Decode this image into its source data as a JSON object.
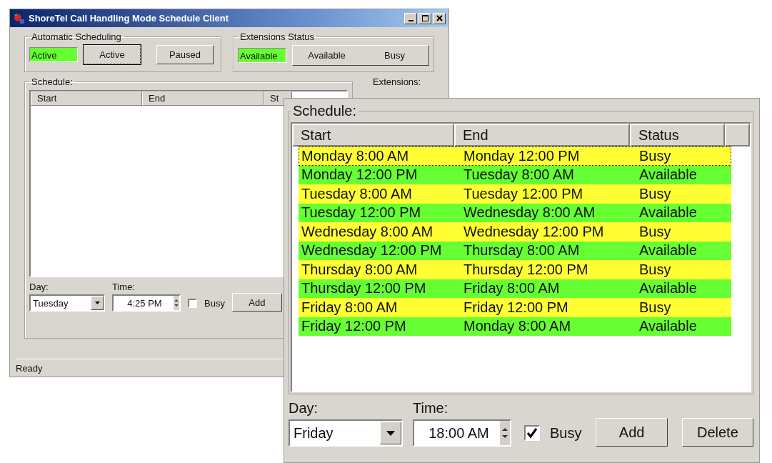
{
  "window": {
    "title": "ShoreTel Call Handling Mode Schedule Client"
  },
  "automatic_scheduling": {
    "label": "Automatic Scheduling",
    "indicator": {
      "text": "Active",
      "color": "#66ff33"
    },
    "buttons": [
      {
        "label": "Active",
        "focused": true
      },
      {
        "label": "Paused",
        "focused": false
      }
    ]
  },
  "extensions_status": {
    "label": "Extensions Status",
    "indicator": {
      "text": "Available",
      "color": "#66ff33"
    },
    "buttons": [
      "Available",
      "Busy"
    ]
  },
  "schedule": {
    "label": "Schedule:",
    "columns": [
      "Start",
      "End",
      "St"
    ],
    "day_label": "Day:",
    "day": "Tuesday",
    "time_label": "Time:",
    "time": "4:25 PM",
    "busy": {
      "label": "Busy",
      "checked": false
    },
    "buttons": [
      "Add"
    ]
  },
  "extensions_label": "Extensions:",
  "status_bar": "Ready",
  "schedule_zoom": {
    "label": "Schedule:",
    "columns": [
      "Start",
      "End",
      "Status"
    ],
    "rows": [
      {
        "cells": [
          "Monday 8:00 AM",
          "Monday 12:00 PM",
          "Busy"
        ],
        "color": "#ffff33",
        "selected": true
      },
      {
        "cells": [
          "Monday 12:00 PM",
          "Tuesday 8:00 AM",
          "Available"
        ],
        "color": "#66ff33",
        "selected": false
      },
      {
        "cells": [
          "Tuesday 8:00 AM",
          "Tuesday 12:00 PM",
          "Busy"
        ],
        "color": "#ffff33",
        "selected": false
      },
      {
        "cells": [
          "Tuesday 12:00 PM",
          "Wednesday 8:00 AM",
          "Available"
        ],
        "color": "#66ff33",
        "selected": false
      },
      {
        "cells": [
          "Wednesday 8:00 AM",
          "Wednesday 12:00 PM",
          "Busy"
        ],
        "color": "#ffff33",
        "selected": false
      },
      {
        "cells": [
          "Wednesday 12:00 PM",
          "Thursday 8:00 AM",
          "Available"
        ],
        "color": "#66ff33",
        "selected": false
      },
      {
        "cells": [
          "Thursday 8:00 AM",
          "Thursday 12:00 PM",
          "Busy"
        ],
        "color": "#ffff33",
        "selected": false
      },
      {
        "cells": [
          "Thursday 12:00 PM",
          "Friday 8:00 AM",
          "Available"
        ],
        "color": "#66ff33",
        "selected": false
      },
      {
        "cells": [
          "Friday 8:00 AM",
          "Friday 12:00 PM",
          "Busy"
        ],
        "color": "#ffff33",
        "selected": false
      },
      {
        "cells": [
          "Friday 12:00 PM",
          "Monday 8:00 AM",
          "Available"
        ],
        "color": "#66ff33",
        "selected": false
      }
    ],
    "day_label": "Day:",
    "day": "Friday",
    "time_label": "Time:",
    "time": "18:00 AM",
    "busy": {
      "label": "Busy",
      "checked": true
    },
    "buttons": [
      "Add",
      "Delete"
    ]
  }
}
